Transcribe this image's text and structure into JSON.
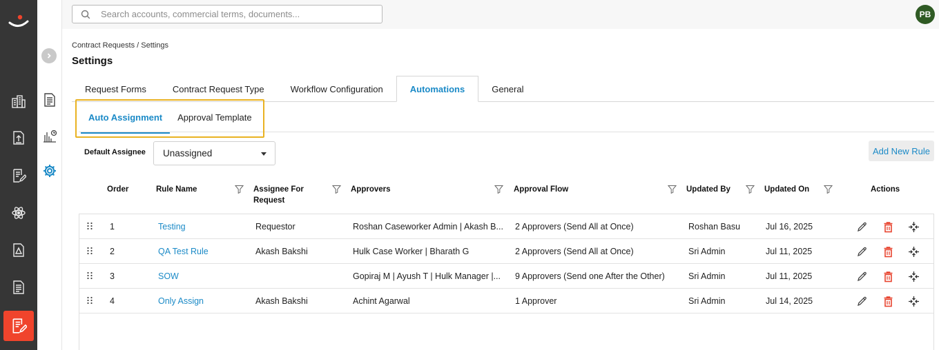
{
  "search": {
    "placeholder": "Search accounts, commercial terms, documents..."
  },
  "user": {
    "initials": "PB"
  },
  "breadcrumb": "Contract Requests / Settings",
  "page_title": "Settings",
  "tabs": [
    {
      "label": "Request Forms"
    },
    {
      "label": "Contract Request Type"
    },
    {
      "label": "Workflow Configuration"
    },
    {
      "label": "Automations"
    },
    {
      "label": "General"
    }
  ],
  "subtabs": [
    {
      "label": "Auto Assignment"
    },
    {
      "label": "Approval Template"
    }
  ],
  "default_assignee": {
    "label": "Default Assignee",
    "value": "Unassigned"
  },
  "add_rule_label": "Add New Rule",
  "columns": {
    "order": "Order",
    "rule_name": "Rule Name",
    "assignee_1": "Assignee For",
    "assignee_2": "Request",
    "approvers": "Approvers",
    "approval_flow": "Approval Flow",
    "updated_by": "Updated By",
    "updated_on": "Updated On",
    "actions": "Actions"
  },
  "rows": [
    {
      "order": "1",
      "rule_name": "Testing",
      "assignee": "Requestor",
      "approvers": "Roshan Caseworker Admin | Akash B...",
      "approval_flow": "2 Approvers (Send All at Once)",
      "updated_by": "Roshan Basu",
      "updated_on": "Jul 16, 2025"
    },
    {
      "order": "2",
      "rule_name": "QA Test Rule",
      "assignee": "Akash Bakshi",
      "approvers": "Hulk Case Worker | Bharath G",
      "approval_flow": "2 Approvers (Send All at Once)",
      "updated_by": "Sri Admin",
      "updated_on": "Jul 11, 2025"
    },
    {
      "order": "3",
      "rule_name": "SOW",
      "assignee": "",
      "approvers": "Gopiraj M | Ayush T | Hulk Manager |...",
      "approval_flow": "9 Approvers (Send one After the Other)",
      "updated_by": "Sri Admin",
      "updated_on": "Jul 11, 2025"
    },
    {
      "order": "4",
      "rule_name": "Only Assign",
      "assignee": "Akash Bakshi",
      "approvers": "Achint Agarwal",
      "approval_flow": "1 Approver",
      "updated_by": "Sri Admin",
      "updated_on": "Jul 14, 2025"
    }
  ],
  "colors": {
    "accent": "#1b8ac7",
    "highlight": "#e9b221",
    "danger": "#e8442f",
    "rail": "#363636",
    "active_tile": "#f0442c",
    "avatar": "#2f5a24"
  }
}
